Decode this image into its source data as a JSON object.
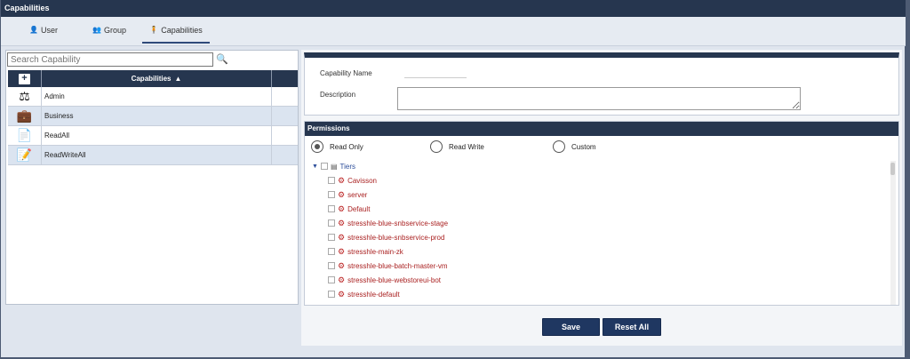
{
  "window": {
    "title": "Capabilities"
  },
  "tabs": [
    {
      "label": "User",
      "icon": "user-icon"
    },
    {
      "label": "Group",
      "icon": "group-icon"
    },
    {
      "label": "Capabilities",
      "icon": "person-icon"
    }
  ],
  "search": {
    "placeholder": "Search Capability",
    "icon": "search-icon"
  },
  "grid": {
    "add_label": "+",
    "header": "Capabilities",
    "sort": "ascending",
    "rows": [
      {
        "name": "Admin",
        "icon": "admin-icon"
      },
      {
        "name": "Business",
        "icon": "briefcase-icon"
      },
      {
        "name": "ReadAll",
        "icon": "document-icon"
      },
      {
        "name": "ReadWriteAll",
        "icon": "edit-document-icon"
      }
    ]
  },
  "detail": {
    "name_label": "Capability Name",
    "name_value": "",
    "description_label": "Description",
    "description_value": ""
  },
  "permissions": {
    "title": "Permissions",
    "options": [
      "Read Only",
      "Read Write",
      "Custom"
    ],
    "selected": "Read Only",
    "tree_root": "Tiers",
    "tree_children": [
      "Cavisson",
      "server",
      "Default",
      "stresshle-blue-snbservice-stage",
      "stresshle-blue-snbservice-prod",
      "stresshle-main-zk",
      "stresshle-blue-batch-master-vm",
      "stresshle-blue-webstoreui-bot",
      "stresshle-default"
    ]
  },
  "actions": {
    "save": "Save",
    "reset": "Reset All"
  },
  "colors": {
    "header": "#26364f",
    "button": "#1f3761",
    "alt_row": "#dbe4f0",
    "tree_child": "#a22222"
  }
}
